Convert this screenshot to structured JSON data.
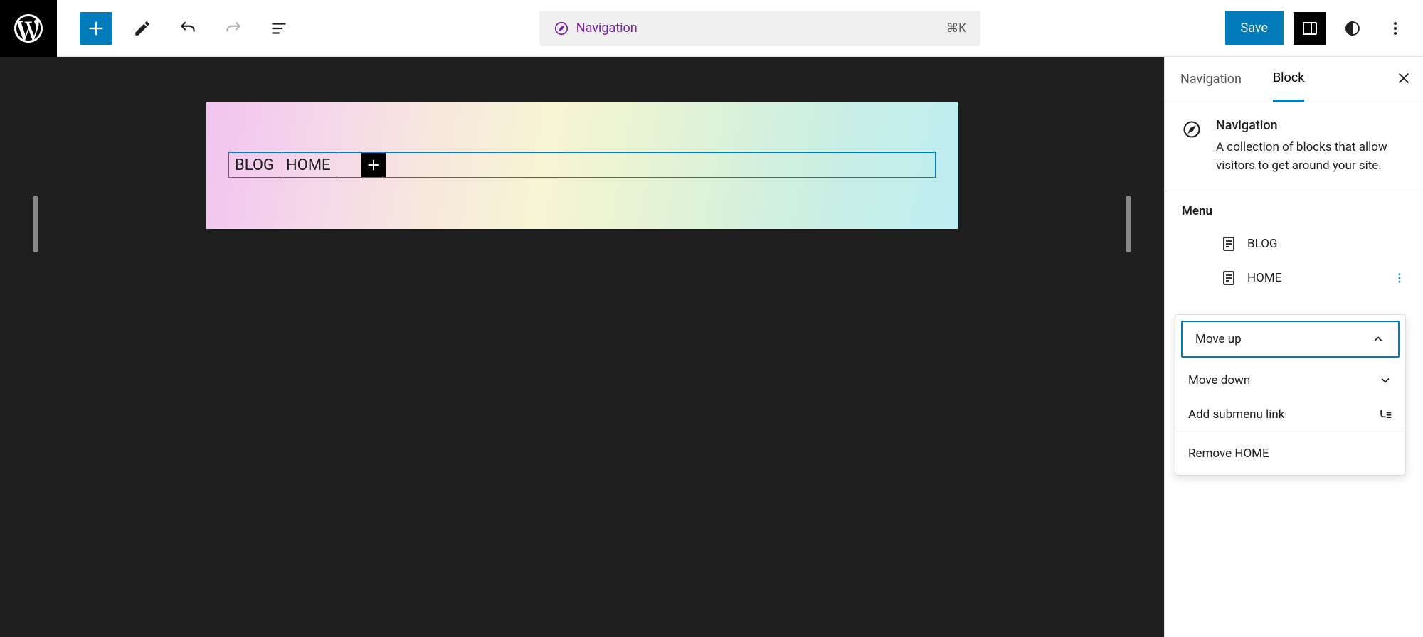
{
  "header": {
    "doc_title": "Navigation",
    "keyboard_shortcut": "⌘K",
    "save_label": "Save"
  },
  "canvas": {
    "nav_items": [
      "BLOG",
      "HOME"
    ]
  },
  "sidebar": {
    "tabs": {
      "nav": "Navigation",
      "block": "Block"
    },
    "block_info": {
      "title": "Navigation",
      "description": "A collection of blocks that allow visitors to get around your site."
    },
    "menu": {
      "heading": "Menu",
      "items": [
        "BLOG",
        "HOME"
      ]
    }
  },
  "popover": {
    "move_up": "Move up",
    "move_down": "Move down",
    "add_submenu": "Add submenu link",
    "remove": "Remove HOME"
  }
}
